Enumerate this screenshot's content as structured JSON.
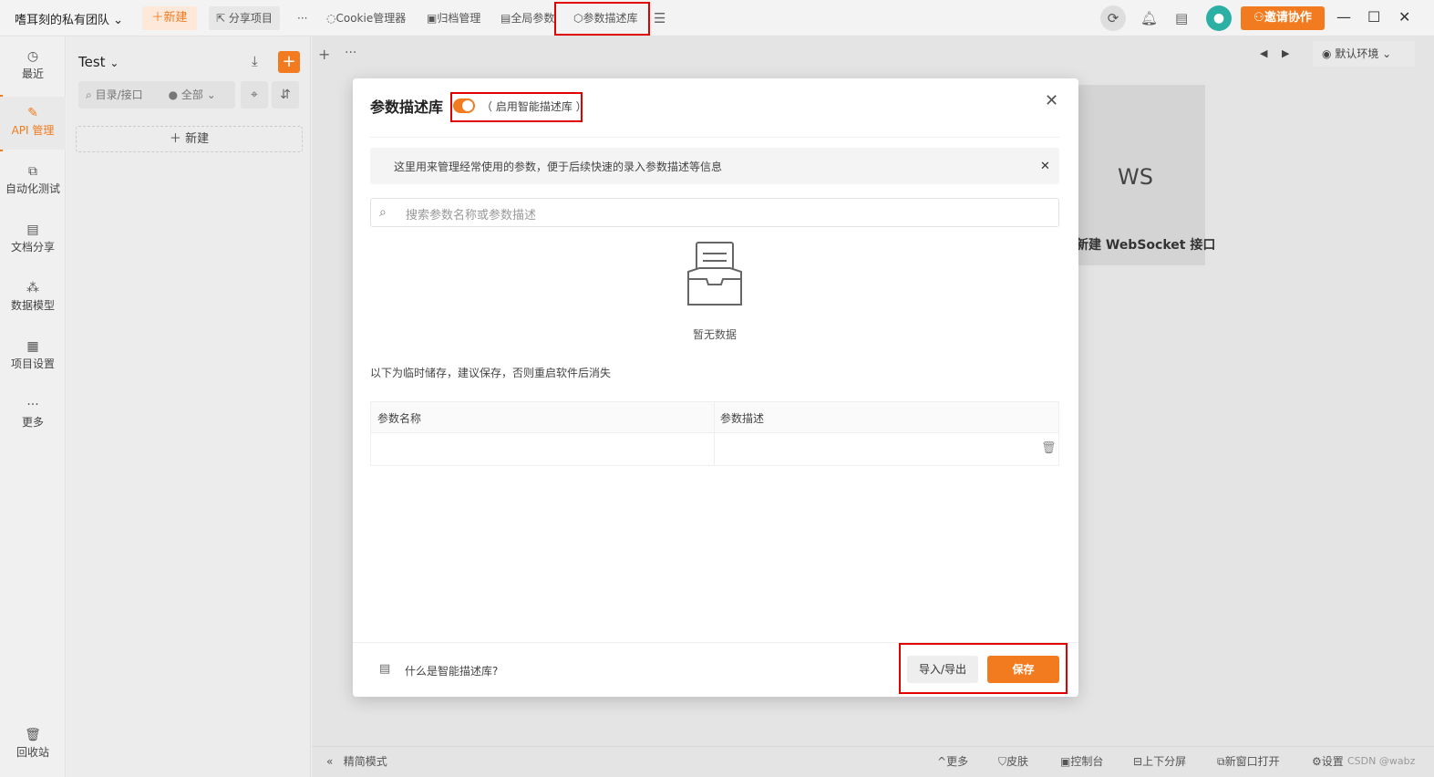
{
  "titlebar": {
    "team_name": "嗜耳刻的私有团队",
    "new_label": "新建",
    "share_label": "分享项目",
    "more": "···",
    "cookie_label": "Cookie管理器",
    "archive_label": "归档管理",
    "global_label": "全局参数",
    "param_lib_label": "参数描述库",
    "invite_label": "邀请协作"
  },
  "leftnav": [
    {
      "label": "最近",
      "icon": "clock-icon"
    },
    {
      "label": "API 管理",
      "icon": "api-icon"
    },
    {
      "label": "自动化测试",
      "icon": "flow-icon"
    },
    {
      "label": "文档分享",
      "icon": "doc-icon"
    },
    {
      "label": "数据模型",
      "icon": "model-icon"
    },
    {
      "label": "项目设置",
      "icon": "settings-icon"
    },
    {
      "label": "更多",
      "icon": "more-icon"
    }
  ],
  "recycle_label": "回收站",
  "sidebar": {
    "project": "Test",
    "search_placeholder": "目录/接口",
    "filter": "全部",
    "new_label": "新建"
  },
  "main": {
    "ws_short": "WS",
    "ws_label": "新建 WebSocket 接口",
    "env_label": "默认环境"
  },
  "bottombar": {
    "simple_mode": "精简模式",
    "more": "更多",
    "skin": "皮肤",
    "console": "控制台",
    "split": "上下分屏",
    "new_window": "新窗口打开",
    "settings": "设置",
    "watermark": "CSDN @wabz"
  },
  "modal": {
    "title": "参数描述库",
    "toggle_label": "（ 启用智能描述库 ）",
    "toggle_on": true,
    "info": "这里用来管理经常使用的参数，便于后续快速的录入参数描述等信息",
    "search_placeholder": "搜索参数名称或参数描述",
    "empty": "暂无数据",
    "temp_note": "以下为临时储存，建议保存，否则重启软件后消失",
    "col_name": "参数名称",
    "col_desc": "参数描述",
    "help": "什么是智能描述库?",
    "import_label": "导入/导出",
    "save_label": "保存"
  },
  "colors": {
    "accent": "#f27b20",
    "highlight": "#e00000"
  }
}
